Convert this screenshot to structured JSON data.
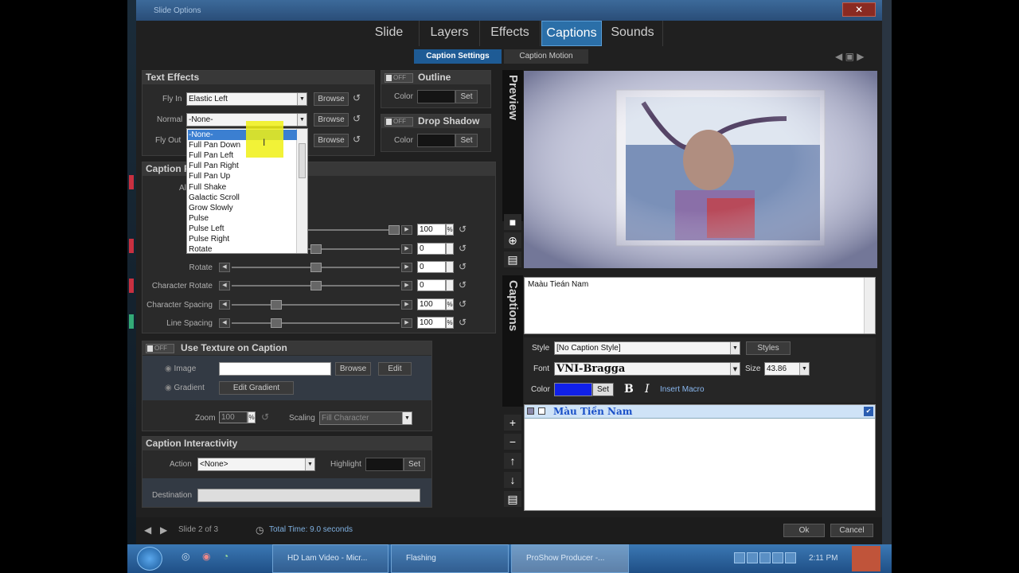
{
  "window": {
    "title": "Slide Options",
    "close": "✕"
  },
  "tabs": [
    "Slide",
    "Layers",
    "Effects",
    "Captions",
    "Sounds"
  ],
  "subtabs": {
    "settings": "Caption Settings",
    "motion": "Caption Motion"
  },
  "text_effects": {
    "title": "Text Effects",
    "fly_in_label": "Fly In",
    "fly_in_value": "Elastic Left",
    "normal_label": "Normal",
    "normal_value": "-None-",
    "fly_out_label": "Fly Out",
    "browse": "Browse"
  },
  "dropdown_items": [
    "-None-",
    "Full Pan Down",
    "Full Pan Left",
    "Full Pan Right",
    "Full Pan Up",
    "Full Shake",
    "Galactic Scroll",
    "Grow Slowly",
    "Pulse",
    "Pulse Left",
    "Pulse Right",
    "Rotate"
  ],
  "outline": {
    "toggle": "OFF",
    "title": "Outline",
    "color_label": "Color",
    "set": "Set"
  },
  "drop_shadow": {
    "toggle": "OFF",
    "title": "Drop Shadow",
    "color_label": "Color",
    "set": "Set"
  },
  "caption_panel": {
    "title_part": "Caption P",
    "al": "Al"
  },
  "sliders": [
    {
      "label": "",
      "value": "100",
      "unit": "%",
      "level": 1.0
    },
    {
      "label": "",
      "value": "0",
      "unit": "",
      "level": 0.5
    },
    {
      "label": "Rotate",
      "value": "0",
      "unit": "",
      "level": 0.5
    },
    {
      "label": "Character Rotate",
      "value": "0",
      "unit": "",
      "level": 0.5
    },
    {
      "label": "Character Spacing",
      "value": "100",
      "unit": "%",
      "level": 0.25
    },
    {
      "label": "Line Spacing",
      "value": "100",
      "unit": "%",
      "level": 0.25
    }
  ],
  "texture": {
    "toggle": "OFF",
    "title": "Use Texture on Caption",
    "image_label": "Image",
    "gradient_label": "Gradient",
    "browse": "Browse",
    "edit": "Edit",
    "edit_gradient": "Edit Gradient",
    "zoom_label": "Zoom",
    "zoom_value": "100",
    "zoom_unit": "%",
    "scaling_label": "Scaling",
    "scaling_value": "Fill Character"
  },
  "interactivity": {
    "title": "Caption Interactivity",
    "action_label": "Action",
    "action_value": "<None>",
    "highlight_label": "Highlight",
    "set": "Set",
    "destination_label": "Destination"
  },
  "preview_label": "Preview",
  "captions_label": "Captions",
  "caption_text": "Maàu Tieán Nam",
  "caption_settings": {
    "style_label": "Style",
    "style_value": "[No Caption Style]",
    "styles_btn": "Styles",
    "font_label": "Font",
    "font_value": "VNI-Bragga",
    "size_label": "Size",
    "size_value": "43.86",
    "color_label": "Color",
    "set": "Set",
    "bold": "B",
    "italic": "I",
    "insert_macro": "Insert Macro",
    "color_value": "#1020e8"
  },
  "caption_list_item": "Màu Tiền Nam",
  "footer": {
    "slide_info": "Slide 2 of 3",
    "total_time": "Total Time: 9.0 seconds",
    "ok": "Ok",
    "cancel": "Cancel"
  },
  "taskbar": {
    "items": [
      "HD Lam Video - Micr...",
      "Flashing",
      "ProShow Producer -..."
    ],
    "clock": "2:11 PM"
  }
}
